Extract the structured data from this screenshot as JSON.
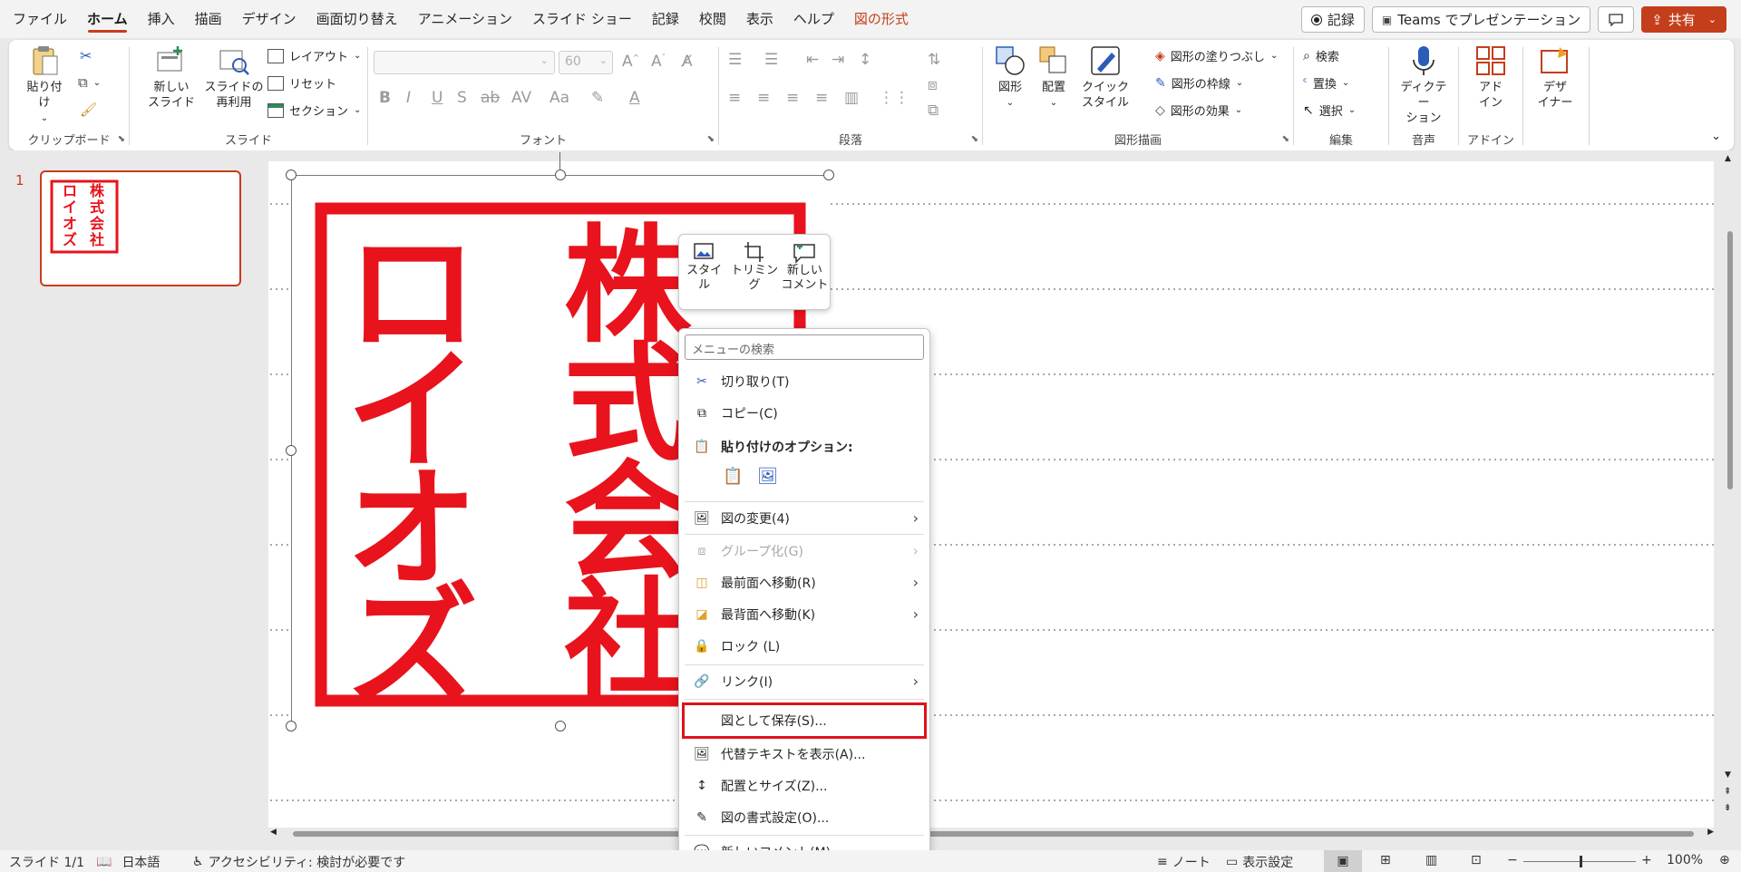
{
  "tabs": [
    {
      "label": "ファイル",
      "state": "normal"
    },
    {
      "label": "ホーム",
      "state": "active"
    },
    {
      "label": "挿入",
      "state": "normal"
    },
    {
      "label": "描画",
      "state": "normal"
    },
    {
      "label": "デザイン",
      "state": "normal"
    },
    {
      "label": "画面切り替え",
      "state": "normal"
    },
    {
      "label": "アニメーション",
      "state": "normal"
    },
    {
      "label": "スライド ショー",
      "state": "normal"
    },
    {
      "label": "記録",
      "state": "normal"
    },
    {
      "label": "校閲",
      "state": "normal"
    },
    {
      "label": "表示",
      "state": "normal"
    },
    {
      "label": "ヘルプ",
      "state": "normal"
    },
    {
      "label": "図の形式",
      "state": "context"
    }
  ],
  "titlebar_buttons": {
    "record": "記録",
    "teams": "Teams でプレゼンテーション",
    "share": "共有"
  },
  "ribbon": {
    "clipboard": {
      "paste": "貼り付け",
      "label": "クリップボード"
    },
    "slides": {
      "new_slide_1": "新しい",
      "new_slide_2": "スライド",
      "reuse_1": "スライドの",
      "reuse_2": "再利用",
      "layout": "レイアウト",
      "reset": "リセット",
      "section": "セクション",
      "label": "スライド"
    },
    "font": {
      "size": "60",
      "label": "フォント"
    },
    "paragraph": {
      "label": "段落"
    },
    "drawing": {
      "shapes": "図形",
      "arrange": "配置",
      "quick_1": "クイック",
      "quick_2": "スタイル",
      "fill": "図形の塗りつぶし",
      "outline": "図形の枠線",
      "effects": "図形の効果",
      "label": "図形描画"
    },
    "editing": {
      "find": "検索",
      "replace": "置換",
      "select": "選択",
      "label": "編集"
    },
    "voice": {
      "dictate_1": "ディクテー",
      "dictate_2": "ション",
      "label": "音声"
    },
    "addins": {
      "addin_1": "アド",
      "addin_2": "イン",
      "label": "アドイン"
    },
    "designer": {
      "label_1": "デザ",
      "label_2": "イナー"
    }
  },
  "thumbnail": {
    "number": "1"
  },
  "seal": {
    "col1": "ロイオズ",
    "col2": "株式会社"
  },
  "mini_toolbar": {
    "style_1": "スタイ",
    "style_2": "ル",
    "trim": "トリミング",
    "comment_1": "新しい",
    "comment_2": "コメント"
  },
  "context_menu": {
    "search_placeholder": "メニューの検索",
    "cut": "切り取り(T)",
    "copy": "コピー(C)",
    "paste_options": "貼り付けのオプション:",
    "change_picture": "図の変更(4)",
    "group": "グループ化(G)",
    "bring_front": "最前面へ移動(R)",
    "send_back": "最背面へ移動(K)",
    "lock": "ロック (L)",
    "link": "リンク(I)",
    "save_as_picture": "図として保存(S)...",
    "alt_text": "代替テキストを表示(A)...",
    "size_position": "配置とサイズ(Z)...",
    "format_picture": "図の書式設定(O)...",
    "new_comment": "新しいコメント(M)"
  },
  "status": {
    "slide": "スライド 1/1",
    "language": "日本語",
    "accessibility": "アクセシビリティ: 検討が必要です",
    "notes": "ノート",
    "display_settings": "表示設定",
    "zoom": "100%"
  },
  "colors": {
    "accent": "#c43e1c",
    "seal_red": "#e8131c",
    "highlight": "#e0101c"
  }
}
